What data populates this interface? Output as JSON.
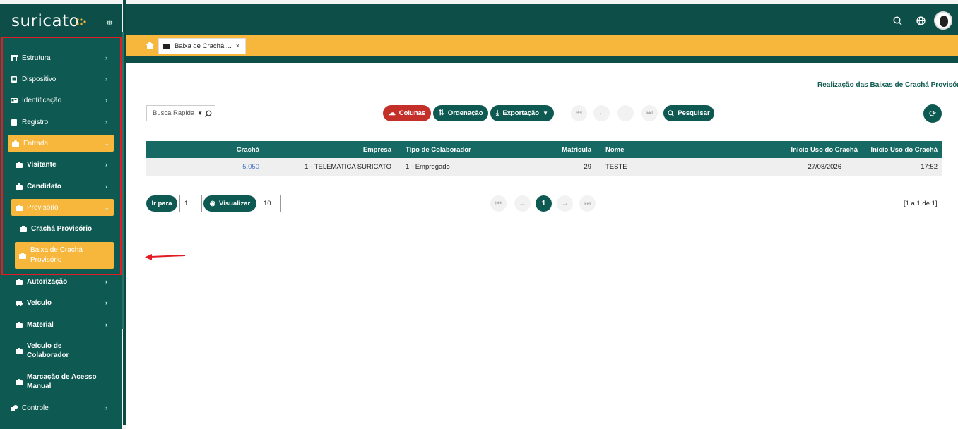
{
  "brand": {
    "name": "suricato"
  },
  "sidebar": {
    "items": [
      {
        "label": "Estrutura",
        "icon": "building-icon"
      },
      {
        "label": "Dispositivo",
        "icon": "device-icon"
      },
      {
        "label": "Identificação",
        "icon": "id-card-icon"
      },
      {
        "label": "Registro",
        "icon": "register-icon"
      },
      {
        "label": "Entrada",
        "icon": "badge-icon"
      },
      {
        "label": "Visitante",
        "icon": "badge-icon"
      },
      {
        "label": "Candidato",
        "icon": "badge-icon"
      },
      {
        "label": "Provisório",
        "icon": "badge-icon"
      },
      {
        "label": "Crachá Provisório",
        "icon": "badge-icon"
      },
      {
        "label": "Baixa de Crachá Provisório",
        "icon": "badge-icon"
      },
      {
        "label": "Autorização",
        "icon": "badge-icon"
      },
      {
        "label": "Veículo",
        "icon": "car-icon"
      },
      {
        "label": "Material",
        "icon": "badge-icon"
      },
      {
        "label": "Veículo de Colaborador",
        "icon": "badge-icon"
      },
      {
        "label": "Marcação de Acesso Manual",
        "icon": "badge-icon"
      },
      {
        "label": "Controle",
        "icon": "control-icon"
      }
    ]
  },
  "topbar": {
    "icons": [
      "search-icon",
      "globe-icon",
      "avatar"
    ]
  },
  "tabs": {
    "active_label": "Baixa de Crachá ...",
    "close": "×"
  },
  "page": {
    "title": "Realização das Baixas de Crachá Provisório"
  },
  "toolbar": {
    "quick_search": "Busca Rapida",
    "columns": "Colunas",
    "order": "Ordenação",
    "export": "Exportação",
    "search": "Pesquisar"
  },
  "table": {
    "headers": [
      "Crachá",
      "Empresa",
      "Tipo de Colaborador",
      "Matricula",
      "Nome",
      "Início Uso do Crachá",
      "Início Uso do Crachá"
    ],
    "rows": [
      [
        "5.050",
        "1 - TELEMATICA SURICATO",
        "1 - Empregado",
        "29",
        "TESTE",
        "27/08/2026",
        "17:52"
      ]
    ]
  },
  "pager": {
    "go_to": "Ir para",
    "go_value": "1",
    "view": "Visualizar",
    "page_size": "10",
    "current": "1",
    "range": "[1 a 1 de 1]"
  },
  "colors": {
    "primary": "#0e5a52",
    "accent": "#f6b73c",
    "danger": "#c42f2a",
    "annotation": "#e31b23"
  }
}
